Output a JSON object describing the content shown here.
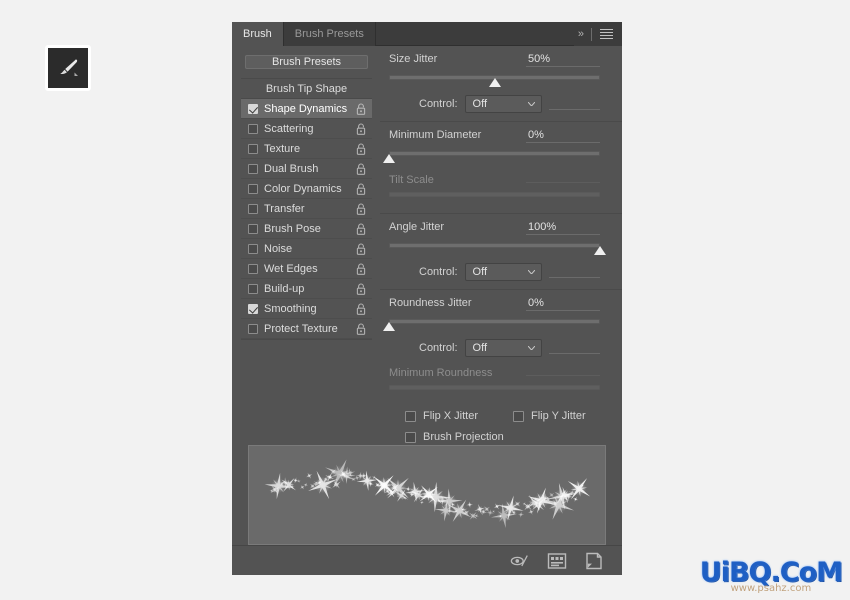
{
  "tool": {
    "name": "brush-tool",
    "icon": "paintbrush-icon"
  },
  "panel": {
    "tabs": [
      {
        "label": "Brush",
        "active": true
      },
      {
        "label": "Brush Presets",
        "active": false
      }
    ],
    "header_icons": {
      "collapse": "»",
      "menu": "panel-menu-icon"
    },
    "presets_button": "Brush Presets"
  },
  "brush_list": {
    "header": "Brush Tip Shape",
    "items": [
      {
        "label": "Shape Dynamics",
        "checked": true,
        "selected": true,
        "locked": true
      },
      {
        "label": "Scattering",
        "checked": false,
        "selected": false,
        "locked": true
      },
      {
        "label": "Texture",
        "checked": false,
        "selected": false,
        "locked": true
      },
      {
        "label": "Dual Brush",
        "checked": false,
        "selected": false,
        "locked": true
      },
      {
        "label": "Color Dynamics",
        "checked": false,
        "selected": false,
        "locked": true
      },
      {
        "label": "Transfer",
        "checked": false,
        "selected": false,
        "locked": true
      },
      {
        "label": "Brush Pose",
        "checked": false,
        "selected": false,
        "locked": true
      },
      {
        "label": "Noise",
        "checked": false,
        "selected": false,
        "locked": true
      },
      {
        "label": "Wet Edges",
        "checked": false,
        "selected": false,
        "locked": true
      },
      {
        "label": "Build-up",
        "checked": false,
        "selected": false,
        "locked": true
      },
      {
        "label": "Smoothing",
        "checked": true,
        "selected": false,
        "locked": true
      },
      {
        "label": "Protect Texture",
        "checked": false,
        "selected": false,
        "locked": true
      }
    ]
  },
  "controls": {
    "size_jitter": {
      "label": "Size Jitter",
      "value": "50%",
      "percent": 50,
      "control_label": "Control:",
      "control_value": "Off"
    },
    "minimum_diameter": {
      "label": "Minimum Diameter",
      "value": "0%",
      "percent": 0
    },
    "tilt_scale": {
      "label": "Tilt Scale",
      "value": "",
      "percent": 0,
      "disabled": true
    },
    "angle_jitter": {
      "label": "Angle Jitter",
      "value": "100%",
      "percent": 100,
      "control_label": "Control:",
      "control_value": "Off"
    },
    "roundness_jitter": {
      "label": "Roundness Jitter",
      "value": "0%",
      "percent": 0,
      "control_label": "Control:",
      "control_value": "Off"
    },
    "minimum_roundness": {
      "label": "Minimum Roundness",
      "value": "",
      "percent": 100,
      "disabled": true
    },
    "flip_x_jitter": {
      "label": "Flip X Jitter",
      "checked": false
    },
    "flip_y_jitter": {
      "label": "Flip Y Jitter",
      "checked": false
    },
    "brush_projection": {
      "label": "Brush Projection",
      "checked": false
    }
  },
  "preview": {
    "name": "brush-stroke-preview",
    "description": "sparkle star brush stroke wave"
  },
  "footer": {
    "icons": [
      {
        "name": "toggle-brush-settings-icon"
      },
      {
        "name": "brush-presets-grid-icon"
      },
      {
        "name": "new-brush-icon"
      }
    ]
  },
  "watermark": {
    "main": "UiBQ.CoM",
    "sub": "www.psahz.com"
  },
  "colors": {
    "panel_bg": "#535353",
    "tabbar_bg": "#3c3c3c",
    "selected_row": "#6a6a6a",
    "text": "#d4d4d4",
    "preview_bg": "#6a6a6a"
  }
}
